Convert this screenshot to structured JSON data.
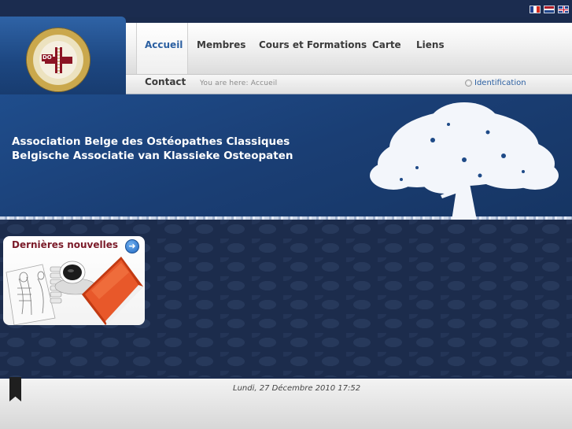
{
  "languages": [
    {
      "name": "fr-flag-icon",
      "colors": [
        "#1f3f8f",
        "#ffffff",
        "#d52b1e"
      ]
    },
    {
      "name": "nl-flag-icon",
      "colors": [
        "#ae1c28",
        "#ffffff",
        "#21468b"
      ]
    },
    {
      "name": "uk-flag-icon",
      "colors": [
        "#1f3f8f",
        "#ffffff",
        "#c8102e"
      ]
    }
  ],
  "logo": {
    "initials": "DO",
    "ring_text": "BELGIAN ASSOCIATION OF CLASSICAL OSTEOPATHY"
  },
  "nav": {
    "items": [
      {
        "label": "Accueil",
        "active": true
      },
      {
        "label": "Membres"
      },
      {
        "label": "Cours et Formations"
      },
      {
        "label": "Carte"
      },
      {
        "label": "Liens"
      },
      {
        "label": "Contact"
      }
    ]
  },
  "breadcrumb": "You are here:  Accueil",
  "login": {
    "label": "Identification"
  },
  "banner": {
    "line1": "Association Belge des Ostéopathes Classiques",
    "line2": "Belgische Associatie van Klassieke Osteopaten"
  },
  "news": {
    "title": "Dernières nouvelles",
    "arrow": "➜"
  },
  "footer": {
    "date": "Lundi, 27 Décembre 2010 17:52"
  },
  "colors": {
    "nav_active": "#2b5fa1",
    "banner_blue": "#1f4d8c",
    "news_title": "#7a1a28",
    "background": "#1c2c4c"
  }
}
